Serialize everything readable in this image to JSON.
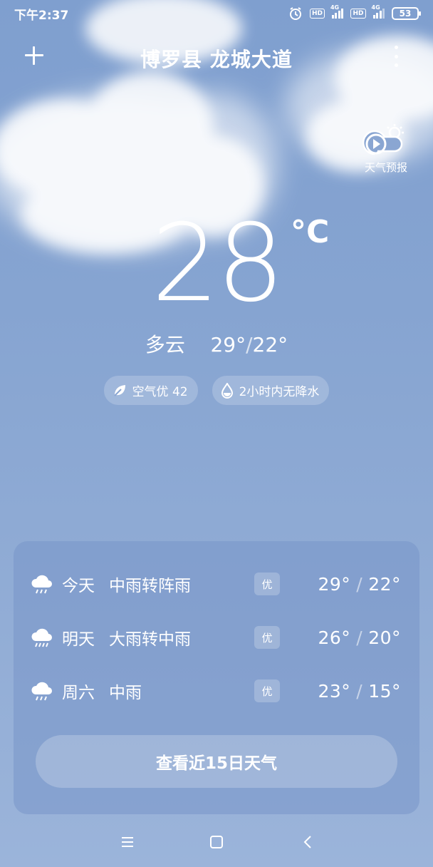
{
  "status_bar": {
    "time": "下午2:37",
    "icons": [
      "alarm-icon",
      "hd-icon",
      "signal-4g-icon",
      "hd-icon",
      "signal-4g-icon"
    ],
    "hd_label": "HD",
    "net_label": "4G",
    "battery": "53"
  },
  "header": {
    "location": "博罗县 龙城大道"
  },
  "forecast_video": {
    "label": "天气预报"
  },
  "current": {
    "temperature": "28",
    "unit": "°C",
    "condition": "多云",
    "high": "29°",
    "low": "22°",
    "separator": "/"
  },
  "chips": [
    {
      "icon": "leaf-icon",
      "label": "空气优 42"
    },
    {
      "icon": "raindrop-icon",
      "label": "2小时内无降水"
    }
  ],
  "daily": [
    {
      "icon": "rain-cloud-icon",
      "day": "今天",
      "desc": "中雨转阵雨",
      "aq": "优",
      "high": "29°",
      "low": "22°"
    },
    {
      "icon": "rain-cloud-icon",
      "day": "明天",
      "desc": "大雨转中雨",
      "aq": "优",
      "high": "26°",
      "low": "20°"
    },
    {
      "icon": "rain-cloud-icon",
      "day": "周六",
      "desc": "中雨",
      "aq": "优",
      "high": "23°",
      "low": "15°"
    }
  ],
  "daily_separator": "/",
  "more_button": "查看近15日天气",
  "colors": {
    "sky_top": "#7f9fcf",
    "sky_bottom": "#9bb4da",
    "text": "#ffffff"
  }
}
